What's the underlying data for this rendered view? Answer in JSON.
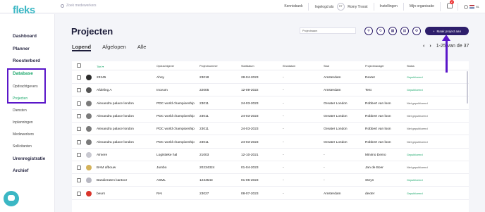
{
  "app": {
    "logo_text": "fleks",
    "search_placeholder": "Zoek medewerkers"
  },
  "topbar": {
    "links": [
      "Kennisbank",
      "Ingelogd als",
      "Romy Troost",
      "Instellingen",
      "Mijn organisatie"
    ],
    "avatar_initials": "RT",
    "notification_count": "2",
    "language": "NL"
  },
  "sidebar": {
    "items": [
      {
        "label": "Dashboard"
      },
      {
        "label": "Planner"
      },
      {
        "label": "Roosterbord"
      },
      {
        "label": "Database",
        "active": true
      },
      {
        "label": "Opdrachtgevers"
      },
      {
        "label": "Projecten",
        "active": true
      },
      {
        "label": "Diensten"
      },
      {
        "label": "Inplanningen"
      },
      {
        "label": "Medewerkers"
      },
      {
        "label": "Sollicitanten"
      },
      {
        "label": "Urenregistratie"
      },
      {
        "label": "Archief"
      }
    ],
    "highlight_color": "#5a16c9"
  },
  "page": {
    "title": "Projecten",
    "search_value": "Projectnaam",
    "add_button_label": "Maak project aan",
    "tabs": [
      "Lopend",
      "Afgelopen",
      "Alle"
    ],
    "active_tab": "Lopend",
    "pagination": "1-25 van de 37"
  },
  "table": {
    "columns": [
      "Titel",
      "Opdrachtgever",
      "Projectnummer",
      "Startdatum",
      "Einddatum",
      "Stad",
      "Projectmanager",
      "Status"
    ],
    "rows": [
      {
        "title": "23245",
        "client": "Ahoy",
        "number": "23018",
        "start": "28-04-2023",
        "end": "-",
        "city": "Amsterdam",
        "manager": "Dexter",
        "status": "Gepubliceerd",
        "published": true,
        "icon_color": "#2b2b2b"
      },
      {
        "title": "Afdeling A",
        "client": "Inovum",
        "number": "22005",
        "start": "12-09-2022",
        "end": "-",
        "city": "Amsterdam",
        "manager": "Test",
        "status": "Gepubliceerd",
        "published": true,
        "icon_color": "#555555"
      },
      {
        "title": "Alexandra palace london",
        "client": "PDC world championship",
        "number": "23011",
        "start": "24-03-2023",
        "end": "-",
        "city": "Greater London",
        "manager": "Robbert van loon",
        "status": "Niet gepubliceerd",
        "published": false,
        "icon_color": "#7a7a7a"
      },
      {
        "title": "Alexandra palace london",
        "client": "PDC world championship",
        "number": "23011",
        "start": "24-03-2023",
        "end": "-",
        "city": "Greater London",
        "manager": "Robbert van loon",
        "status": "Niet gepubliceerd",
        "published": false,
        "icon_color": "#7a7a7a"
      },
      {
        "title": "Alexandra palace london",
        "client": "PDC world championship",
        "number": "23011",
        "start": "24-03-2023",
        "end": "-",
        "city": "Greater London",
        "manager": "Robbert van loon",
        "status": "Niet gepubliceerd",
        "published": false,
        "icon_color": "#7a7a7a"
      },
      {
        "title": "Alexandra palace london",
        "client": "PDC world championship",
        "number": "23011",
        "start": "24-03-2023",
        "end": "-",
        "city": "Greater London",
        "manager": "Robbert van loon",
        "status": "Niet gepubliceerd",
        "published": false,
        "icon_color": "#7a7a7a"
      },
      {
        "title": "Almere",
        "client": "Logistieke hal",
        "number": "21003",
        "start": "12-10-2021",
        "end": "-",
        "city": "-",
        "manager": "Minimo Demo",
        "status": "Gepubliceerd",
        "published": true,
        "icon_color": "#c8c8d0"
      },
      {
        "title": "BAM afbouw",
        "client": "Jumbo",
        "number": "20234324",
        "start": "01-04-2023",
        "end": "-",
        "city": "-",
        "manager": "Jan de Boer",
        "status": "Niet gepubliceerd",
        "published": false,
        "icon_color": "#d4b25a"
      },
      {
        "title": "Bandieraten kantoor",
        "client": "ASML",
        "number": "1234543",
        "start": "01-06-2023",
        "end": "-",
        "city": "-",
        "manager": "Steyn",
        "status": "Gepubliceerd",
        "published": true,
        "icon_color": "#b8b8c2"
      },
      {
        "title": "beurs",
        "client": "RAI",
        "number": "23027",
        "start": "08-07-2023",
        "end": "-",
        "city": "Amsterdam",
        "manager": "dexter",
        "status": "Gepubliceerd",
        "published": true,
        "icon_color": "#d9342b"
      }
    ]
  },
  "colors": {
    "accent": "#2d1e6b",
    "success": "#1ba86b",
    "brand": "#3bb7c4",
    "annotation": "#5a16c9"
  }
}
